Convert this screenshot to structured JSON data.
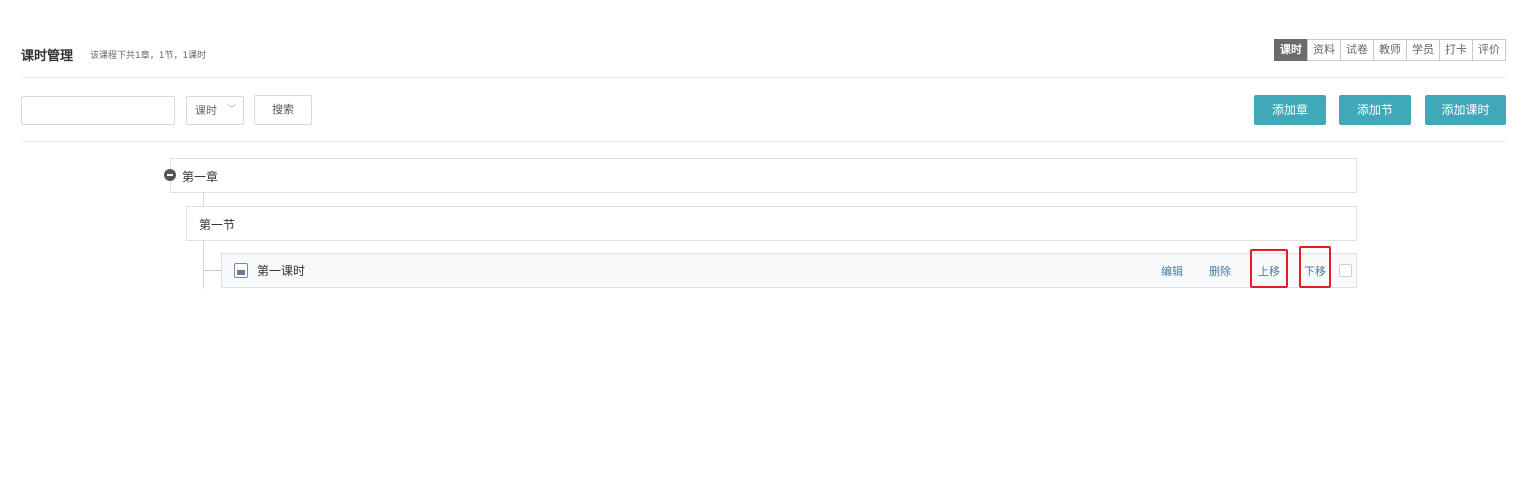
{
  "header": {
    "title": "课时管理",
    "summary": "该课程下共1章，1节，1课时"
  },
  "tabs": [
    {
      "label": "课时",
      "active": true
    },
    {
      "label": "资料",
      "active": false
    },
    {
      "label": "试卷",
      "active": false
    },
    {
      "label": "教师",
      "active": false
    },
    {
      "label": "学员",
      "active": false
    },
    {
      "label": "打卡",
      "active": false
    },
    {
      "label": "评价",
      "active": false
    }
  ],
  "toolbar": {
    "search_value": "",
    "type_select": {
      "value": "课时",
      "icon": "chevron-down-icon"
    },
    "search_button": "搜索",
    "add_chapter": "添加章",
    "add_section": "添加节",
    "add_lesson": "添加课时"
  },
  "tree": {
    "chapter": {
      "label": "第一章",
      "icon": "collapse-minus-icon"
    },
    "section": {
      "label": "第一节"
    },
    "lesson": {
      "label": "第一课时",
      "icon": "video-file-icon",
      "actions": {
        "edit": "编辑",
        "delete": "删除",
        "move_up": "上移",
        "move_down": "下移"
      },
      "checked": false
    }
  },
  "colors": {
    "primary": "#3fa8b9",
    "active_tab": "#6b6b6b",
    "link": "#4a7ba8",
    "highlight": "#e02020"
  }
}
